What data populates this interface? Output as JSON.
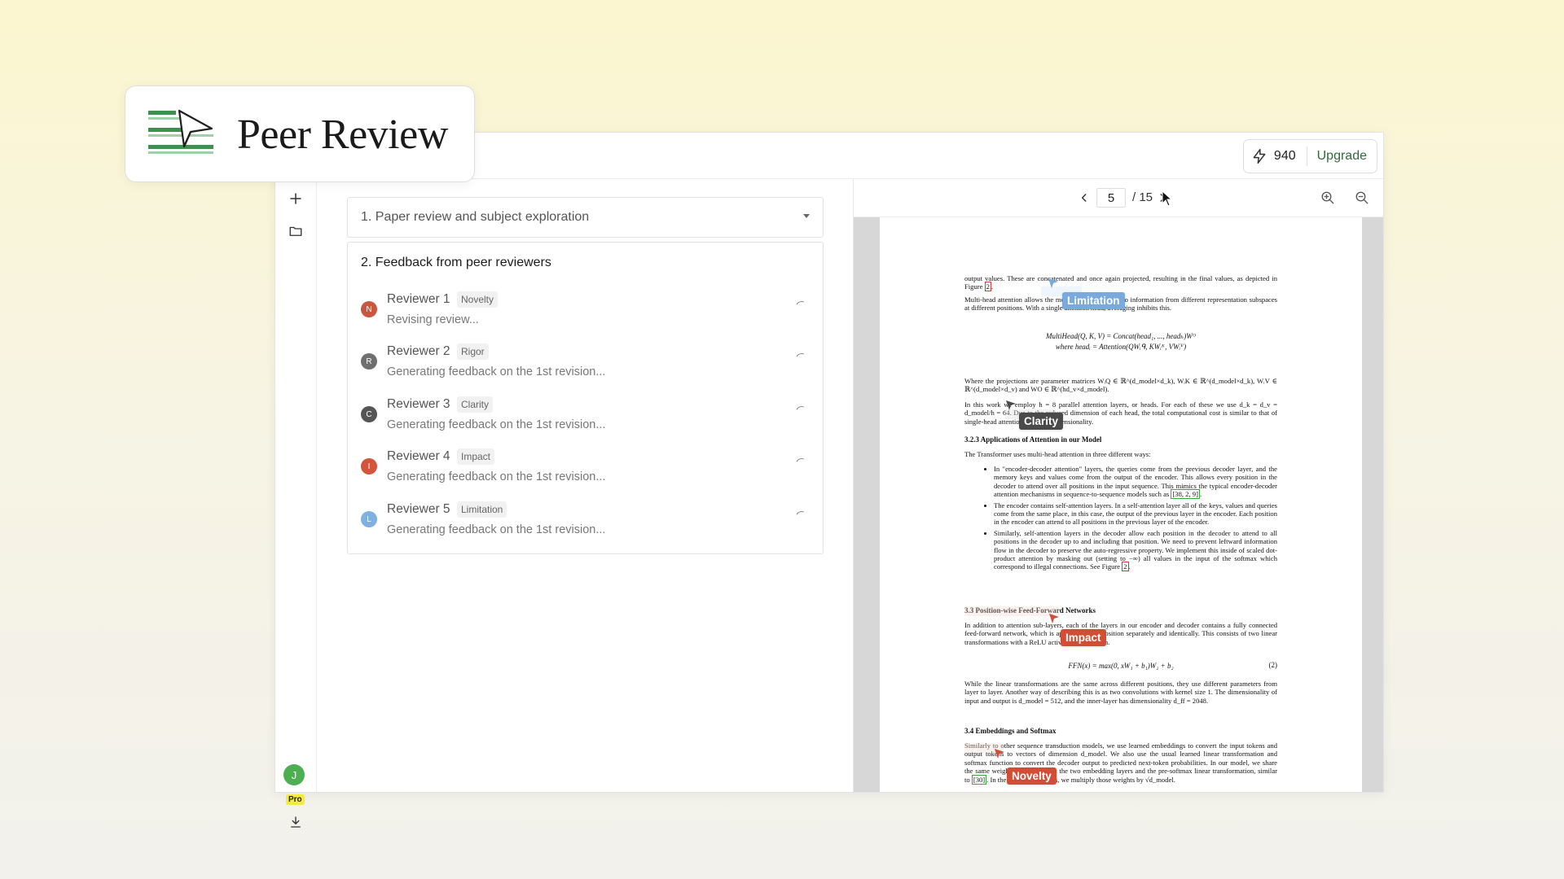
{
  "brand": {
    "title": "Peer Review",
    "icon": "paper-plane-lines-icon"
  },
  "header": {
    "credits": "940",
    "upgrade_label": "Upgrade",
    "credits_icon": "bolt-icon"
  },
  "rail": {
    "avatar_initial": "J",
    "pro_label": "Pro"
  },
  "steps": {
    "step1_label": "1. Paper review and subject exploration",
    "step2_title": "2. Feedback from peer reviewers"
  },
  "reviewers": [
    {
      "initial": "N",
      "name": "Reviewer 1",
      "tag": "Novelty",
      "status": "Revising review...",
      "color": "#c9563d"
    },
    {
      "initial": "R",
      "name": "Reviewer 2",
      "tag": "Rigor",
      "status": "Generating feedback on the 1st revision...",
      "color": "#6f6f6f"
    },
    {
      "initial": "C",
      "name": "Reviewer 3",
      "tag": "Clarity",
      "status": "Generating feedback on the 1st revision...",
      "color": "#555555"
    },
    {
      "initial": "I",
      "name": "Reviewer 4",
      "tag": "Impact",
      "status": "Generating feedback on the 1st revision...",
      "color": "#d2553c"
    },
    {
      "initial": "L",
      "name": "Reviewer 5",
      "tag": "Limitation",
      "status": "Generating feedback on the 1st revision...",
      "color": "#7fb0e0"
    }
  ],
  "viewer": {
    "page": "5",
    "total": "/ 15"
  },
  "highlights": {
    "limitation": {
      "label": "Limitation",
      "color": "#79a9dd"
    },
    "clarity": {
      "label": "Clarity",
      "color": "#4a4a4a"
    },
    "impact": {
      "label": "Impact",
      "color": "#d24d35"
    },
    "novelty": {
      "label": "Novelty",
      "color": "#d24d35"
    }
  },
  "paper": {
    "p1": "output values. These are concatenated and once again projected, resulting in the final values, as depicted in Figure",
    "fig2": "2",
    "p2": "Multi-head attention allows the model to jointly attend to information from different representation subspaces at different positions. With a single attention head, averaging inhibits this.",
    "eq1a": "MultiHead(Q, K, V) = Concat(head₁, ..., headₕ)Wᴼ",
    "eq1b": "where headᵢ = Attention(QWᵢᑫ, KWᵢᴷ, VWᵢⱽ)",
    "p3": "Where the projections are parameter matrices WᵢQ ∈ ℝ^(d_model×d_k), WᵢK ∈ ℝ^(d_model×d_k), WᵢV ∈ ℝ^(d_model×d_v) and WO ∈ ℝ^(hd_v×d_model).",
    "p4": "In this work we employ h = 8 parallel attention layers, or heads. For each of these we use d_k = d_v = d_model/h = 64. Due to the reduced dimension of each head, the total computational cost is similar to that of single-head attention with full dimensionality.",
    "h323": "3.2.3   Applications of Attention in our Model",
    "p5": "The Transformer uses multi-head attention in three different ways:",
    "li1": "In \"encoder-decoder attention\" layers, the queries come from the previous decoder layer, and the memory keys and values come from the output of the encoder. This allows every position in the decoder to attend over all positions in the input sequence. This mimics the typical encoder-decoder attention mechanisms in sequence-to-sequence models such as",
    "li1refs": "[38, 2, 9]",
    "li2": "The encoder contains self-attention layers. In a self-attention layer all of the keys, values and queries come from the same place, in this case, the output of the previous layer in the encoder. Each position in the encoder can attend to all positions in the previous layer of the encoder.",
    "li3": "Similarly, self-attention layers in the decoder allow each position in the decoder to attend to all positions in the decoder up to and including that position. We need to prevent leftward information flow in the decoder to preserve the auto-regressive property. We implement this inside of scaled dot-product attention by masking out (setting to −∞) all values in the input of the softmax which correspond to illegal connections. See Figure",
    "h33": "3.3   Position-wise Feed-Forward Networks",
    "p6": "In addition to attention sub-layers, each of the layers in our encoder and decoder contains a fully connected feed-forward network, which is applied to each position separately and identically. This consists of two linear transformations with a ReLU activation in between.",
    "eq2": "FFN(x) = max(0, xW₁ + b₁)W₂ + b₂",
    "eq2num": "(2)",
    "p7": "While the linear transformations are the same across different positions, they use different parameters from layer to layer. Another way of describing this is as two convolutions with kernel size 1. The dimensionality of input and output is d_model = 512, and the inner-layer has dimensionality d_ff = 2048.",
    "h34": "3.4   Embeddings and Softmax",
    "p8": "Similarly to other sequence transduction models, we use learned embeddings to convert the input tokens and output tokens to vectors of dimension d_model. We also use the usual learned linear transformation and softmax function to convert the decoder output to predicted next-token probabilities. In our model, we share the same weight matrix between the two embedding layers and the pre-softmax linear transformation, similar to",
    "ref30": "[30]",
    "p8b": ". In the embedding layers, we multiply those weights by √d_model."
  }
}
